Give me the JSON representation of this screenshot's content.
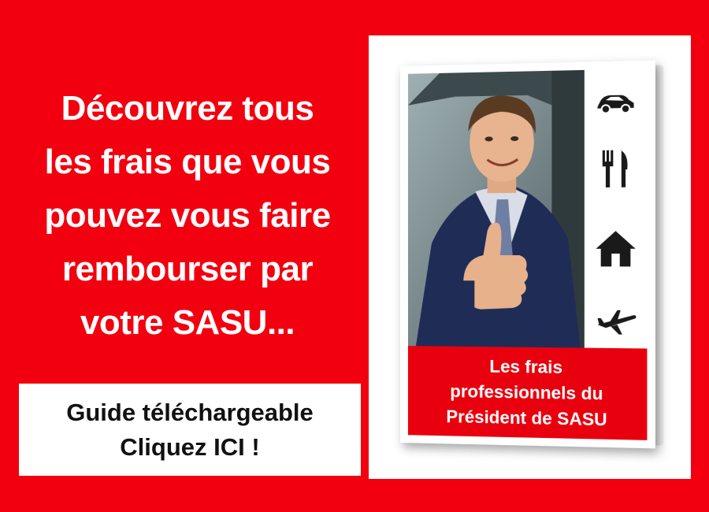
{
  "headline": {
    "lines": [
      "Découvrez tous",
      "les frais que vous",
      "pouvez vous faire",
      "rembourser par",
      "votre SASU..."
    ]
  },
  "cta": {
    "line1": "Guide téléchargeable",
    "line2": "Cliquez ICI !"
  },
  "book": {
    "title_lines": [
      "Les frais",
      "professionnels du",
      "Président de SASU"
    ],
    "icons": [
      "car-icon",
      "fork-knife-icon",
      "house-icon",
      "airplane-icon"
    ]
  },
  "colors": {
    "brand_red": "#f2000f",
    "cover_red": "#e8000e",
    "white": "#ffffff",
    "icon_dark": "#1a1a1a"
  }
}
